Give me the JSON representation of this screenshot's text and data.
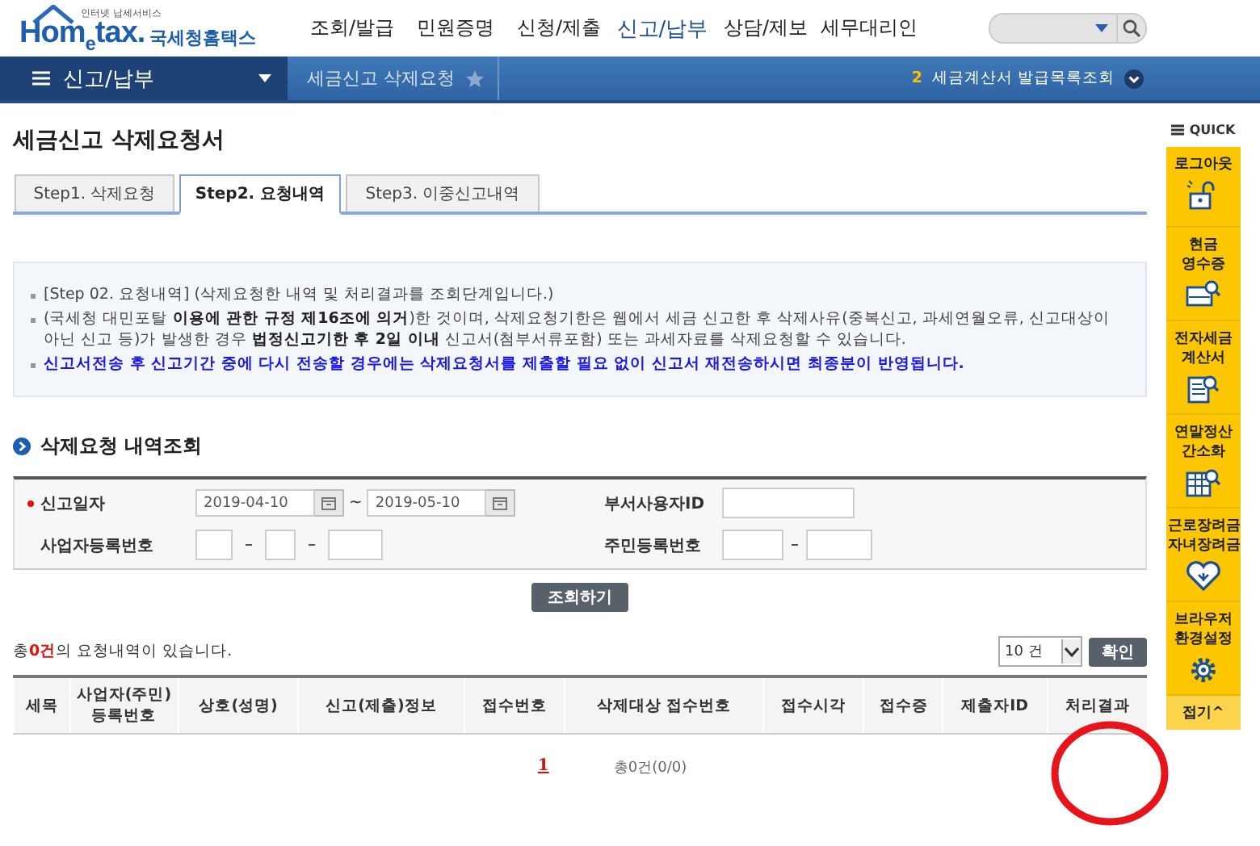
{
  "header": {
    "logo_tagline": "인터넷 납세서비스",
    "logo": "Hom$_{e}$tax.",
    "logo_korean": "국세청홈택스",
    "menu": [
      {
        "label": "조회/발급",
        "selected": false
      },
      {
        "label": "민원증명",
        "selected": false
      },
      {
        "label": "신청/제출",
        "selected": false
      },
      {
        "label": "신고/납부",
        "selected": true
      },
      {
        "label": "상담/제보",
        "selected": false
      },
      {
        "label": "세무대리인",
        "selected": false
      }
    ]
  },
  "breadcrumb": {
    "menu": "신고/납부",
    "current": "세금신고 삭제요청",
    "favorite": false,
    "rank": "2",
    "recent": "세금계산서 발급목록조회"
  },
  "page_title": "세금신고 삭제요청서",
  "steps": [
    {
      "label": "Step1. 삭제요청",
      "selected": false
    },
    {
      "label": "Step2. 요청내역",
      "selected": true
    },
    {
      "label": "Step3. 이중신고내역",
      "selected": false
    }
  ],
  "notice": [
    {
      "kind": "normal",
      "text": "[Step 02. 요청내역] (삭제요청한 내역 및 처리결과를 조회단계입니다.)"
    },
    {
      "kind": "normal",
      "text": "(국세청 대민포탈 **이용에 관한 규정 제16조에 의거**)한 것이며, 삭제요청기한은 웹에서 세금 신고한 후 삭제사유(중복신고, 과세연월오류, 신고대상이 아닌 신고 등)가 발생한 경우 **법정신고기한 후 2일 이내** 신고서(첨부서류포함) 또는 과세자료를 삭제요청할 수 있습니다."
    },
    {
      "kind": "emphasis",
      "text": "신고서전송 후 신고기간 중에 다시 전송할 경우에는 삭제요청서를 제출할 필요 없이 신고서 재전송하시면 최종분이 반영됩니다."
    }
  ],
  "search": {
    "title": "삭제요청 내역조회",
    "date_label": "신고일자",
    "date_from": "2019-04-10",
    "date_sep": "~",
    "date_to": "2019-05-10",
    "dept_label": "부서사용자ID",
    "biz_label": "사업자등록번호",
    "rrn_label": "주민등록번호",
    "button": "조회하기"
  },
  "result": {
    "summary": "총**0건**의 요청내역이 있습니다.",
    "page_size": "10 건",
    "confirm": "확인",
    "columns": [
      "세목",
      "사업자(주민) 등록번호",
      "상호(성명)",
      "신고(제출)정보",
      "접수번호",
      "삭제대상 접수번호",
      "접수시각",
      "접수증",
      "제출자ID",
      "처리결과"
    ],
    "page": "1",
    "total": "총0건(0/0)"
  },
  "quick": {
    "title": "QUICK",
    "items": [
      {
        "label": "로그아웃",
        "kind": "lock"
      },
      {
        "label": "현금 영수증",
        "kind": "receipt"
      },
      {
        "label": "전자세금 계산서",
        "kind": "invoice"
      },
      {
        "label": "연말정산 간소화",
        "kind": "table"
      },
      {
        "label": "근로장려금 자녀장려금",
        "kind": "heart"
      },
      {
        "label": "브라우저 환경설정",
        "kind": "gear"
      }
    ],
    "collapse": "접기^"
  },
  "annotation": {
    "kind": "circle"
  }
}
